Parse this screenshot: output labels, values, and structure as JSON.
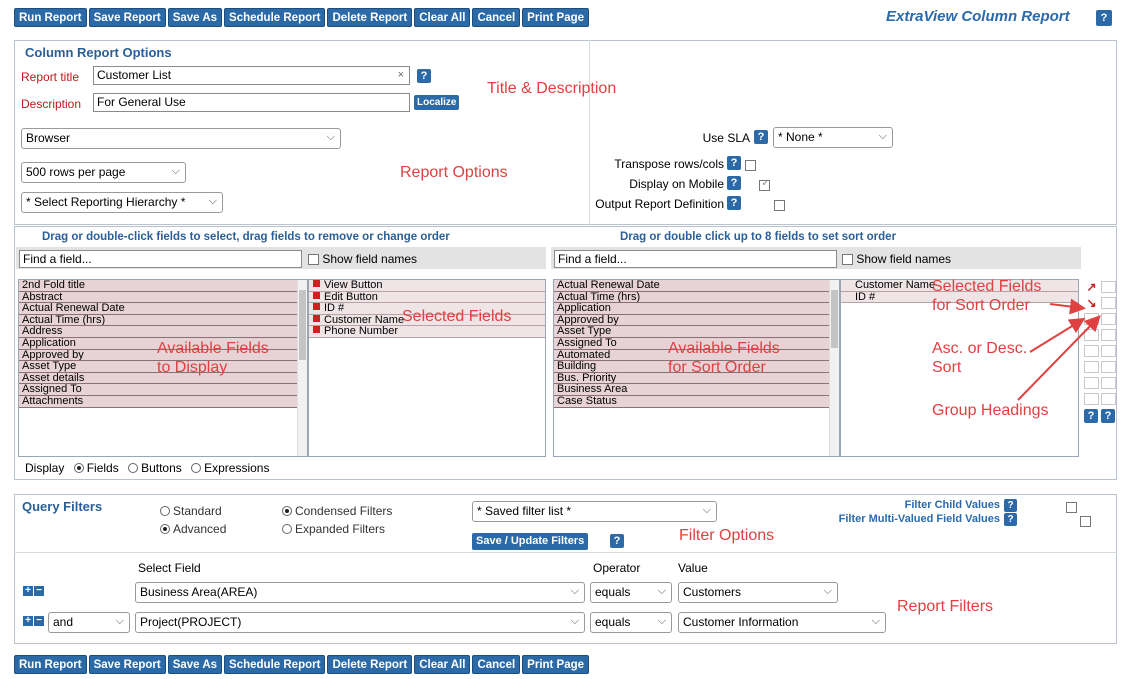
{
  "toolbar": {
    "buttons": [
      "Run Report",
      "Save Report",
      "Save As",
      "Schedule Report",
      "Delete Report",
      "Clear All",
      "Cancel",
      "Print Page"
    ],
    "page_title": "ExtraView Column Report",
    "help": "?"
  },
  "options": {
    "header": "Column Report Options",
    "report_title_label": "Report title",
    "report_title_value": "Customer List",
    "description_label": "Description",
    "description_value": "For General Use",
    "localize_label": "Localize",
    "output_select": "Browser",
    "rows_select": "500 rows per page",
    "hierarchy_select": "* Select Reporting Hierarchy *",
    "use_sla_label": "Use SLA",
    "use_sla_value": "* None *",
    "transpose_label": "Transpose rows/cols",
    "mobile_label": "Display on Mobile",
    "output_def_label": "Output Report Definition",
    "mobile_checked": true
  },
  "fields": {
    "display_header": "Drag or double-click fields to select, drag fields to remove or change order",
    "sort_header": "Drag or double click up to 8 fields to set sort order",
    "find_placeholder": "Find a field...",
    "show_names_label": "Show field names",
    "available_display": [
      "2nd Fold title",
      "Abstract",
      "Actual Renewal Date",
      "Actual Time (hrs)",
      "Address",
      "Application",
      "Approved by",
      "Asset Type",
      "Asset details",
      "Assigned To",
      "Attachments"
    ],
    "selected_display": [
      "View Button",
      "Edit Button",
      "ID #",
      "Customer Name",
      "Phone Number"
    ],
    "available_sort": [
      "Actual Renewal Date",
      "Actual Time (hrs)",
      "Application",
      "Approved by",
      "Asset Type",
      "Assigned To",
      "Automated",
      "Building",
      "Bus. Priority",
      "Business Area",
      "Case Status"
    ],
    "selected_sort": [
      "Customer Name",
      "ID #"
    ],
    "display_label": "Display",
    "display_options": [
      "Fields",
      "Buttons",
      "Expressions"
    ]
  },
  "filters": {
    "header": "Query Filters",
    "standard": "Standard",
    "advanced": "Advanced",
    "condensed": "Condensed Filters",
    "expanded": "Expanded Filters",
    "saved_filter": "* Saved filter list *",
    "save_update": "Save / Update Filters",
    "child_values": "Filter Child Values",
    "multi_values": "Filter Multi-Valued Field Values",
    "col_select_field": "Select Field",
    "col_operator": "Operator",
    "col_value": "Value",
    "rows": [
      {
        "conj": "",
        "field": "Business Area(AREA)",
        "operator": "equals",
        "value": "Customers"
      },
      {
        "conj": "and",
        "field": "Project(PROJECT)",
        "operator": "equals",
        "value": "Customer Information"
      }
    ]
  },
  "annotations": {
    "title_desc": "Title & Description",
    "report_options": "Report Options",
    "selected_fields": "Selected Fields",
    "available_display_1": "Available Fields",
    "available_display_2": "to Display",
    "available_sort_1": "Available Fields",
    "available_sort_2": "for Sort Order",
    "selected_sort_1": "Selected Fields",
    "selected_sort_2": "for Sort Order",
    "asc_desc_1": "Asc. or Desc.",
    "asc_desc_2": "Sort",
    "group_headings": "Group Headings",
    "filter_options": "Filter Options",
    "report_filters": "Report Filters"
  },
  "colors": {
    "button_blue": "#2b6aa6",
    "annotation_red": "#e04040",
    "field_pink": "#e7d3d6"
  }
}
